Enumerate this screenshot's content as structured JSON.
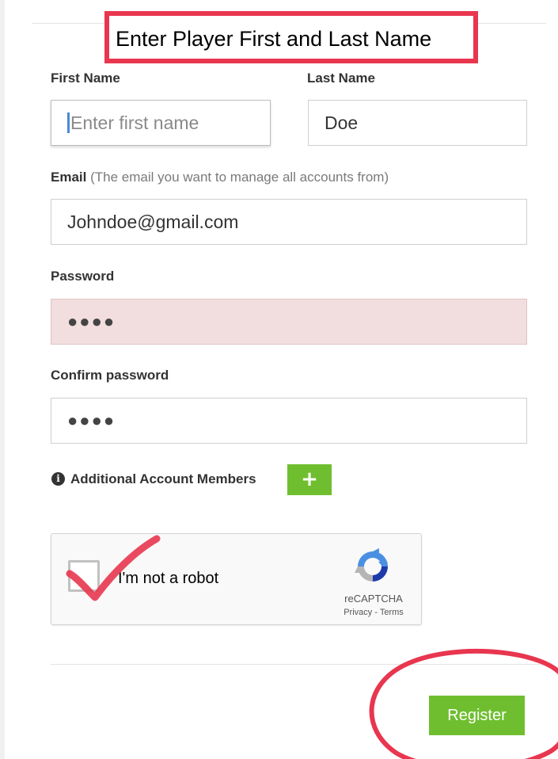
{
  "annotation": {
    "instruction": "Enter Player First and Last Name",
    "color": "#e8364f"
  },
  "form": {
    "first_name": {
      "label": "First Name",
      "value": "",
      "placeholder": "Enter first name"
    },
    "last_name": {
      "label": "Last Name",
      "value": "Doe"
    },
    "email": {
      "label": "Email",
      "help": "(The email you want to manage all accounts from)",
      "value": "Johndoe@gmail.com"
    },
    "password": {
      "label": "Password",
      "masked_value": "●●●●",
      "state": "error",
      "background": "#f2dede"
    },
    "confirm_password": {
      "label": "Confirm password",
      "masked_value": "●●●●"
    },
    "additional_members": {
      "label": "Additional Account Members",
      "info_icon": "info-icon",
      "add_button_label": "+",
      "add_button_icon": "plus-icon"
    },
    "register_button": {
      "label": "Register"
    },
    "accent_color": "#6fbe2f"
  },
  "captcha": {
    "label": "I'm not a robot",
    "brand": "reCAPTCHA",
    "privacy_link": "Privacy",
    "separator": "-",
    "terms_link": "Terms",
    "checked": true,
    "logo_icon": "recaptcha-logo-icon"
  }
}
